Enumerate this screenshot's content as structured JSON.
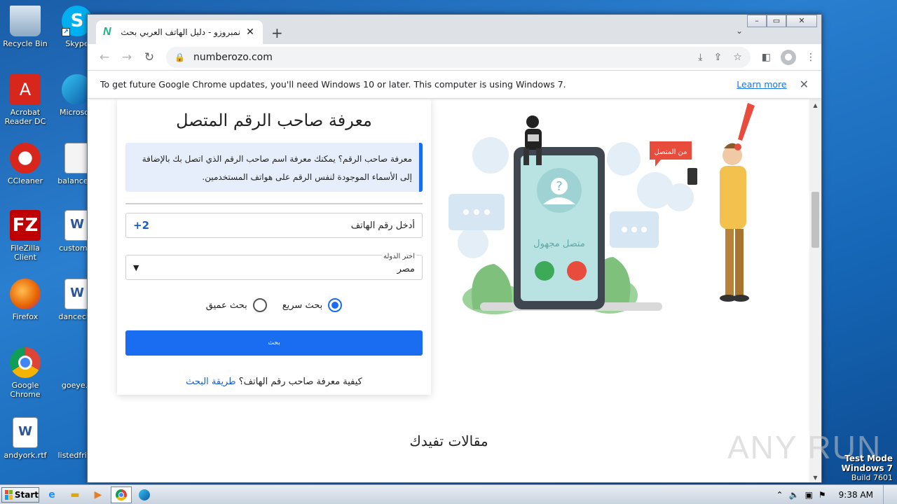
{
  "desktop": {
    "icons": [
      {
        "label": "Recycle Bin"
      },
      {
        "label": "Skype"
      },
      {
        "label": "Acrobat Reader DC"
      },
      {
        "label": "Microsoft"
      },
      {
        "label": "CCleaner"
      },
      {
        "label": "balancecc"
      },
      {
        "label": "FileZilla Client"
      },
      {
        "label": "customer"
      },
      {
        "label": "Firefox"
      },
      {
        "label": "dancecha"
      },
      {
        "label": "Google Chrome"
      },
      {
        "label": "goeye.p"
      },
      {
        "label": "andyork.rtf"
      },
      {
        "label": "listedfrida"
      }
    ]
  },
  "browser": {
    "tab_title": "نمبروزو - دليل الهاتف العربي بحث بالا",
    "tab_favicon": "N",
    "url": "numberozo.com",
    "infobar_message": "To get future Google Chrome updates, you'll need Windows 10 or later. This computer is using Windows 7.",
    "infobar_link": "Learn more"
  },
  "page": {
    "heading": "معرفة صاحب الرقم المتصل",
    "note": "معرفة صاحب الرقم؟ يمكنك معرفة اسم صاحب الرقم الذي اتصل بك بالإضافة إلى الأسماء الموجودة لنفس الرقم على هواتف المستخدمين.",
    "phone_placeholder": "أدخل رقم الهاتف",
    "phone_code": "+2",
    "country_label": "اختر الدولة",
    "country_value": "مصر",
    "radio_quick": "بحث سريع",
    "radio_deep": "بحث عميق",
    "search_button": "بحث",
    "howto_text": "كيفية معرفة صاحب رقم الهاتف؟",
    "howto_link": "طريقة البحث",
    "articles_heading": "مقالات تفيدك",
    "illus_badge": "من المتصل",
    "illus_screen": "متصل مجهول"
  },
  "taskbar": {
    "start_label": "Start",
    "clock": "9:38 AM"
  },
  "watermark": {
    "line1": "Test Mode",
    "line2": "Windows 7",
    "line3": "Build 7601",
    "brand": "ANY RUN"
  },
  "colors": {
    "accent": "#1a6cf0",
    "link": "#1a73e8"
  }
}
